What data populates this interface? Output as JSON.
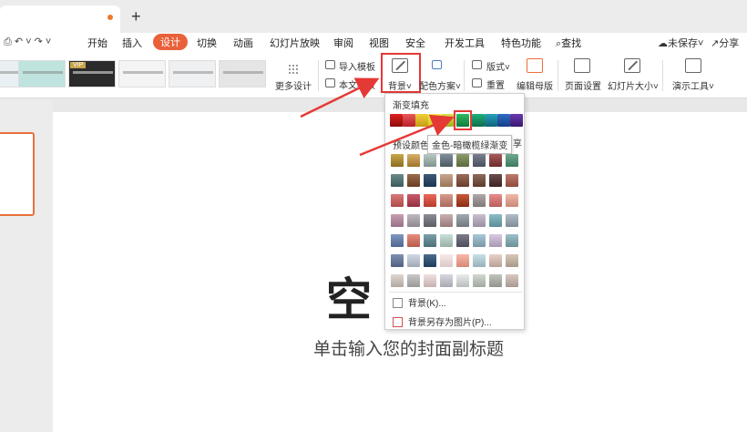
{
  "menubar": {
    "items": [
      "开始",
      "插入",
      "设计",
      "切换",
      "动画",
      "幻灯片放映",
      "审阅",
      "视图",
      "安全",
      "开发工具",
      "特色功能"
    ],
    "active_index": 2,
    "search_label": "查找",
    "unsaved_label": "未保存",
    "share_label": "分享"
  },
  "ribbon": {
    "vip_badge": "VIP",
    "more_design": "更多设计",
    "import_template": "导入模板",
    "this_doc_template": "本文模板",
    "background": "背景",
    "color_scheme": "配色方案",
    "layout": "版式",
    "reset": "重置",
    "edit_master": "编辑母版",
    "page_setup": "页面设置",
    "slide_size": "幻灯片大小",
    "present_tools": "演示工具"
  },
  "slide": {
    "title_visible": "空",
    "subtitle": "单击输入您的封面副标题"
  },
  "dropdown": {
    "gradient_fill_label": "渐变填充",
    "row2_label_partial": "预设颜色",
    "share_partial": "享",
    "tooltip": "金色-暗橄榄绿渐变",
    "bg_item": "背景(K)...",
    "save_bg_item": "背景另存为图片(P)..."
  },
  "colors": {
    "accent": "#e8613a",
    "highlight": "#e53935",
    "preset_row": [
      "#c0161c",
      "#e0434c",
      "#e8c52b",
      "#ede229",
      "#c5d62b",
      "#1a9c4b",
      "#1aa56b",
      "#1a8fa0",
      "#1a56a8",
      "#1a2c8f",
      "#6b2f9c"
    ]
  }
}
